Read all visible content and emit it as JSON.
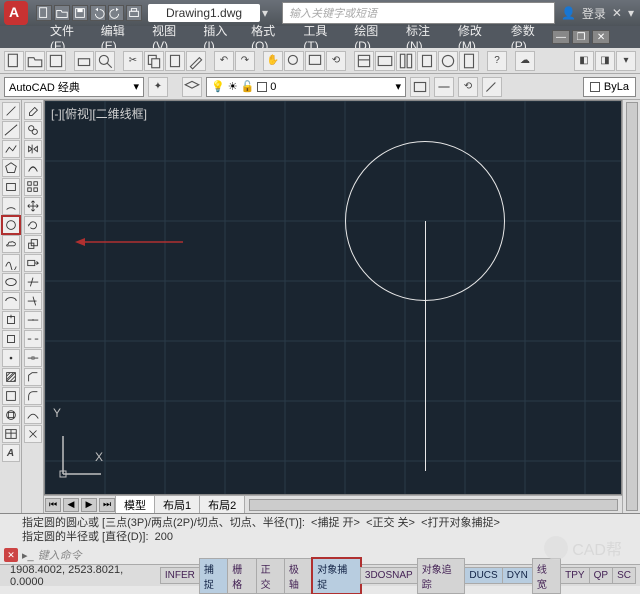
{
  "title": "Drawing1.dwg",
  "search_placeholder": "输入关键字或短语",
  "login_label": "登录",
  "menus": [
    "文件(F)",
    "编辑(E)",
    "视图(V)",
    "插入(I)",
    "格式(O)",
    "工具(T)",
    "绘图(D)",
    "标注(N)",
    "修改(M)",
    "参数(P)"
  ],
  "workspace": {
    "label": "AutoCAD 经典"
  },
  "layer": {
    "name": "0"
  },
  "bylayer_label": "ByLa",
  "viewport_label": "[-][俯视][二维线框]",
  "ucs": {
    "x": "X",
    "y": "Y"
  },
  "tabs": {
    "model": "模型",
    "layout1": "布局1",
    "layout2": "布局2"
  },
  "command_history": "指定圆的圆心或 [三点(3P)/两点(2P)/切点、切点、半径(T)]:  <捕捉 开>  <正交 关>  <打开对象捕捉>\n指定圆的半径或 [直径(D)]:  200",
  "command_prompt": "键入命令",
  "status": {
    "coords": "1908.4002, 2523.8021, 0.0000",
    "toggles": [
      "INFER",
      "捕捉",
      "栅格",
      "正交",
      "极轴",
      "对象捕捉",
      "3DOSNAP",
      "对象追踪",
      "DUCS",
      "DYN",
      "线宽",
      "TPY",
      "QP",
      "SC"
    ]
  },
  "watermark": "CAD帮"
}
